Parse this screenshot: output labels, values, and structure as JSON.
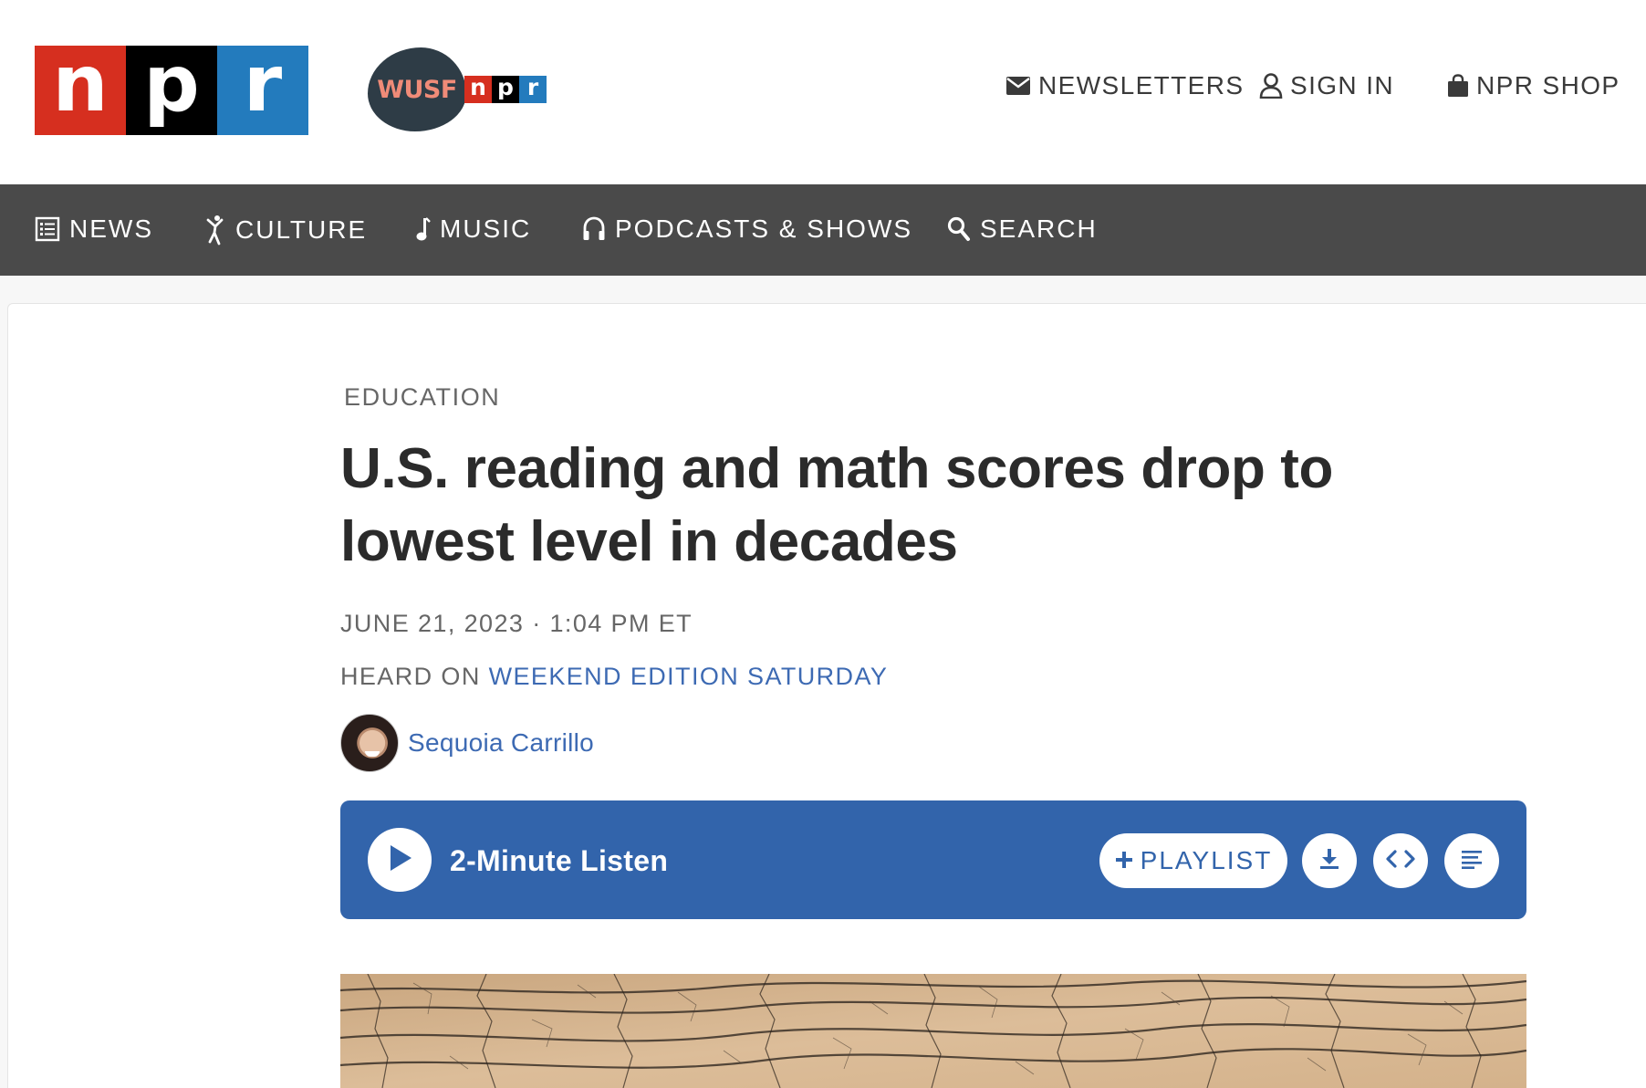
{
  "header": {
    "logo_letters": [
      "n",
      "p",
      "r"
    ],
    "station_name": "WUSF",
    "station_npr_letters": [
      "n",
      "p",
      "r"
    ],
    "utility_links": [
      {
        "label": "NEWSLETTERS",
        "icon": "envelope-icon"
      },
      {
        "label": "SIGN IN",
        "icon": "user-icon"
      },
      {
        "label": "NPR SHOP",
        "icon": "shopping-bag-icon"
      }
    ]
  },
  "nav": {
    "items": [
      {
        "label": "NEWS",
        "icon": "newspaper-icon"
      },
      {
        "label": "CULTURE",
        "icon": "dancer-icon"
      },
      {
        "label": "MUSIC",
        "icon": "music-note-icon"
      },
      {
        "label": "PODCASTS & SHOWS",
        "icon": "headphones-icon"
      },
      {
        "label": "SEARCH",
        "icon": "search-icon"
      }
    ]
  },
  "article": {
    "slug": "EDUCATION",
    "headline": "U.S. reading and math scores drop to lowest level in decades",
    "dateline": "JUNE 21, 2023 · 1:04 PM ET",
    "heard_on_label": "HEARD ON ",
    "heard_on_program": "WEEKEND EDITION SATURDAY",
    "author": "Sequoia Carrillo"
  },
  "player": {
    "title": "2-Minute Listen",
    "playlist_label": "PLAYLIST",
    "buttons": [
      "play-icon",
      "plus-icon",
      "download-icon",
      "embed-icon",
      "transcript-icon"
    ]
  },
  "colors": {
    "npr_red": "#d62f1f",
    "npr_black": "#000000",
    "npr_blue": "#237bbd",
    "nav_bg": "#4a4a4a",
    "link_blue": "#3d6ab3",
    "player_blue": "#3264ab"
  }
}
